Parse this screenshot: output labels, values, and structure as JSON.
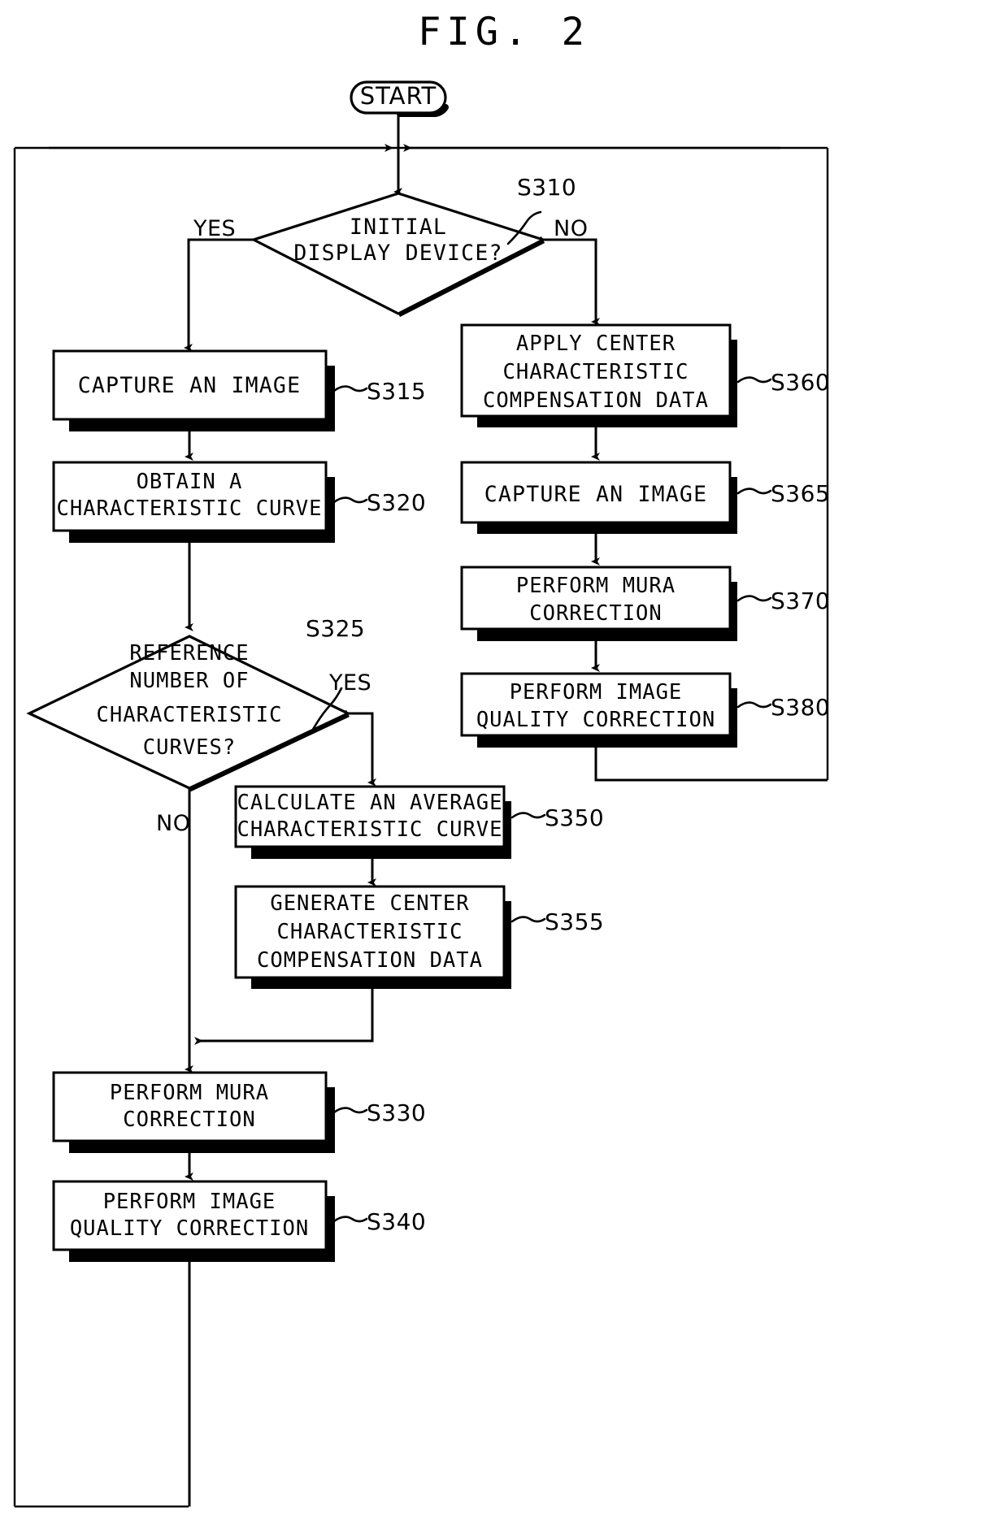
{
  "figure": {
    "title": "FIG. 2",
    "start_label": "START"
  },
  "nodes": {
    "s310": {
      "ref": "S310",
      "line1": "INITIAL",
      "line2": "DISPLAY DEVICE?",
      "yes_label": "YES",
      "no_label": "NO"
    },
    "s315": {
      "ref": "S315",
      "line1": "CAPTURE AN IMAGE"
    },
    "s320": {
      "ref": "S320",
      "line1": "OBTAIN A",
      "line2": "CHARACTERISTIC CURVE"
    },
    "s325": {
      "ref": "S325",
      "line1": "REFERENCE",
      "line2": "NUMBER OF",
      "line3": "CHARACTERISTIC",
      "line4": "CURVES?",
      "yes_label": "YES",
      "no_label": "NO"
    },
    "s330": {
      "ref": "S330",
      "line1": "PERFORM MURA",
      "line2": "CORRECTION"
    },
    "s340": {
      "ref": "S340",
      "line1": "PERFORM IMAGE",
      "line2": "QUALITY CORRECTION"
    },
    "s350": {
      "ref": "S350",
      "line1": "CALCULATE AN AVERAGE",
      "line2": "CHARACTERISTIC CURVE"
    },
    "s355": {
      "ref": "S355",
      "line1": "GENERATE CENTER",
      "line2": "CHARACTERISTIC",
      "line3": "COMPENSATION DATA"
    },
    "s360": {
      "ref": "S360",
      "line1": "APPLY CENTER",
      "line2": "CHARACTERISTIC",
      "line3": "COMPENSATION DATA"
    },
    "s365": {
      "ref": "S365",
      "line1": "CAPTURE AN IMAGE"
    },
    "s370": {
      "ref": "S370",
      "line1": "PERFORM MURA",
      "line2": "CORRECTION"
    },
    "s380": {
      "ref": "S380",
      "line1": "PERFORM IMAGE",
      "line2": "QUALITY CORRECTION"
    }
  },
  "colors": {
    "ink": "#000000",
    "paper": "#ffffff"
  }
}
